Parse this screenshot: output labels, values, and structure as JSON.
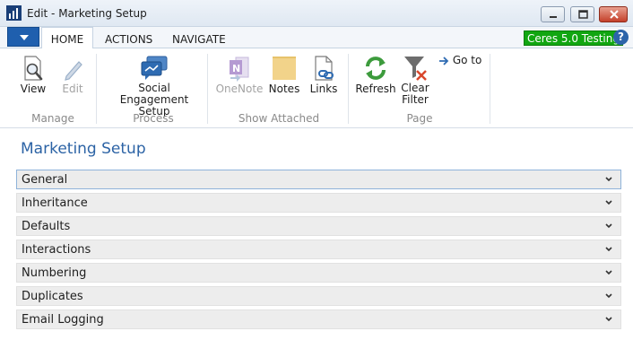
{
  "window": {
    "title": "Edit - Marketing Setup"
  },
  "tabs": {
    "home": "HOME",
    "actions": "ACTIONS",
    "navigate": "NAVIGATE"
  },
  "environment_badge": "Ceres 5.0 Testing",
  "help_glyph": "?",
  "ribbon": {
    "groups": [
      {
        "label": "Manage",
        "buttons": [
          {
            "label": "View",
            "icon": "view-icon",
            "enabled": true
          },
          {
            "label": "Edit",
            "icon": "pencil-icon",
            "enabled": false
          }
        ]
      },
      {
        "label": "Process",
        "buttons": [
          {
            "label_line1": "Social",
            "label_line2": "Engagement Setup",
            "icon": "social-engagement-icon",
            "enabled": true
          }
        ]
      },
      {
        "label": "Show Attached",
        "buttons": [
          {
            "label": "OneNote",
            "icon": "onenote-icon",
            "enabled": false
          },
          {
            "label": "Notes",
            "icon": "note-icon",
            "enabled": true
          },
          {
            "label": "Links",
            "icon": "link-icon",
            "enabled": true
          }
        ]
      },
      {
        "label": "Page",
        "buttons": [
          {
            "label": "Refresh",
            "icon": "refresh-icon",
            "enabled": true
          },
          {
            "label_line1": "Clear",
            "label_line2": "Filter",
            "icon": "clear-filter-icon",
            "enabled": true
          },
          {
            "label": "Go to",
            "icon": "arrow-right-icon",
            "enabled": true
          }
        ]
      }
    ]
  },
  "page_title": "Marketing Setup",
  "fasttabs": [
    "General",
    "Inheritance",
    "Defaults",
    "Interactions",
    "Numbering",
    "Duplicates",
    "Email Logging"
  ],
  "colors": {
    "accent": "#2c63a5",
    "badge": "#11a611",
    "app_menu": "#1f5fae"
  }
}
